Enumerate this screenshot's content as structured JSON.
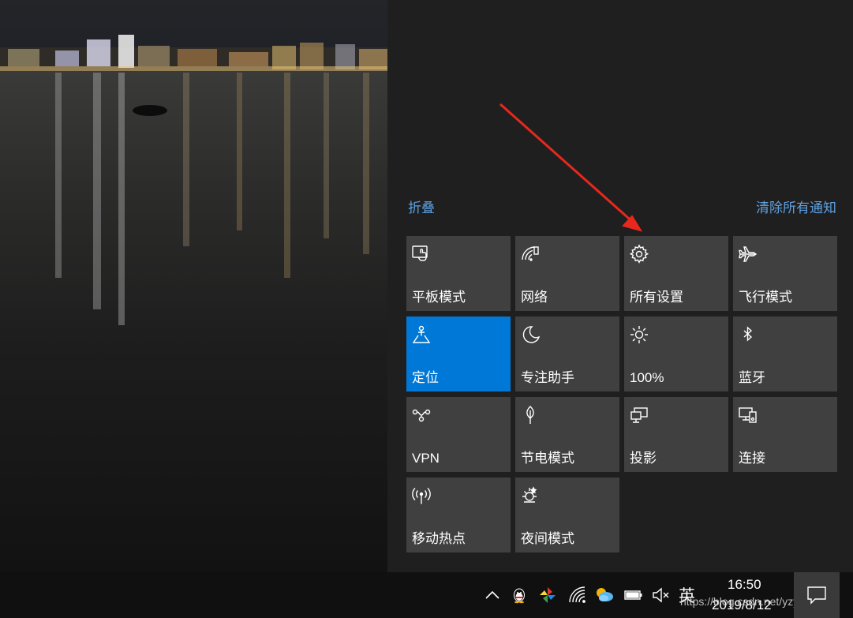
{
  "action_center": {
    "collapse_label": "折叠",
    "clear_all_label": "清除所有通知",
    "tiles": [
      {
        "label": "平板模式",
        "icon": "tablet-mode-icon",
        "active": false
      },
      {
        "label": "网络",
        "icon": "network-icon",
        "active": false
      },
      {
        "label": "所有设置",
        "icon": "gear-icon",
        "active": false
      },
      {
        "label": "飞行模式",
        "icon": "airplane-icon",
        "active": false
      },
      {
        "label": "定位",
        "icon": "location-icon",
        "active": true
      },
      {
        "label": "专注助手",
        "icon": "moon-icon",
        "active": false
      },
      {
        "label": "100%",
        "icon": "brightness-icon",
        "active": false
      },
      {
        "label": "蓝牙",
        "icon": "bluetooth-icon",
        "active": false
      },
      {
        "label": "VPN",
        "icon": "vpn-icon",
        "active": false
      },
      {
        "label": "节电模式",
        "icon": "battery-saver-icon",
        "active": false
      },
      {
        "label": "投影",
        "icon": "project-icon",
        "active": false
      },
      {
        "label": "连接",
        "icon": "connect-icon",
        "active": false
      },
      {
        "label": "移动热点",
        "icon": "hotspot-icon",
        "active": false
      },
      {
        "label": "夜间模式",
        "icon": "night-light-icon",
        "active": false
      }
    ]
  },
  "taskbar": {
    "ime_label": "英",
    "time": "16:50",
    "date": "2019/8/12",
    "tray_icons": [
      "chevron-up-icon",
      "qq-icon",
      "pinwheel-icon",
      "wifi-icon",
      "cloud-app-icon",
      "battery-icon",
      "volume-muted-icon"
    ]
  },
  "watermark": "https://blog.csdn.net/yzyggu",
  "colors": {
    "panel_bg": "#1f1f1f",
    "tile_bg": "#404040",
    "tile_active": "#0078d7",
    "link": "#5ea0df",
    "annotation_arrow": "#e8281e"
  }
}
